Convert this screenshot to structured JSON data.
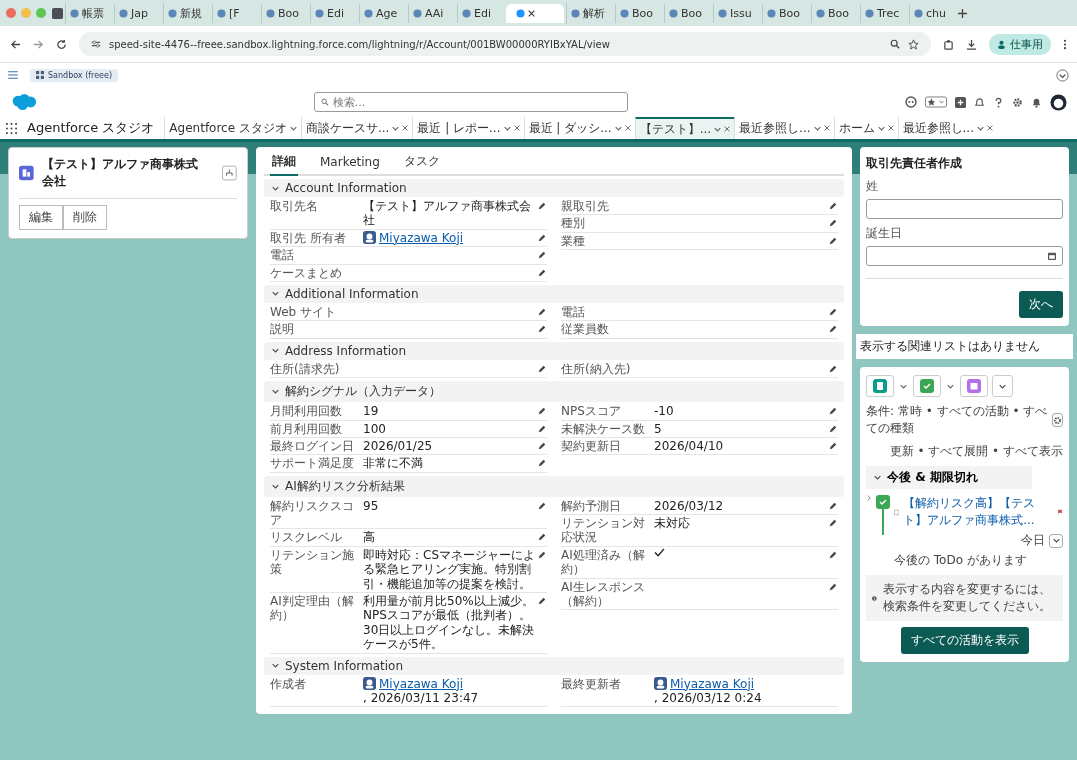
{
  "browser": {
    "tabs": [
      {
        "label": "帳票",
        "selected": false
      },
      {
        "label": "Jap",
        "selected": false
      },
      {
        "label": "新規",
        "selected": false
      },
      {
        "label": "[F",
        "selected": false
      },
      {
        "label": "Boo",
        "selected": false
      },
      {
        "label": "Edi",
        "selected": false
      },
      {
        "label": "Age",
        "selected": false
      },
      {
        "label": "AAi",
        "selected": false
      },
      {
        "label": "Edi",
        "selected": false
      },
      {
        "selected": true
      },
      {
        "label": "解析",
        "selected": false
      },
      {
        "label": "Boo",
        "selected": false
      },
      {
        "label": "Boo",
        "selected": false
      },
      {
        "label": "Issu",
        "selected": false
      },
      {
        "label": "Boo",
        "selected": false
      },
      {
        "label": "Boo",
        "selected": false
      },
      {
        "label": "Trec",
        "selected": false
      },
      {
        "label": "chu",
        "selected": false
      }
    ],
    "address": "speed-site-4476--freee.sandbox.lightning.force.com/lightning/r/Account/001BW00000RYIBxYAL/view",
    "profile": "仕事用"
  },
  "sandbox": "Sandbox (freee)",
  "search": {
    "placeholder": "検索..."
  },
  "app_name": "Agentforce スタジオ",
  "workspace_tabs": [
    {
      "label": "Agentforce スタジオ",
      "selected": false
    },
    {
      "label": "商談ケースサ...",
      "selected": false
    },
    {
      "label": "最近 | レポー...",
      "selected": false
    },
    {
      "label": "最近 | ダッシ...",
      "selected": false
    },
    {
      "label": "【テスト】...",
      "selected": true
    },
    {
      "label": "最近参照し...",
      "selected": false
    },
    {
      "label": "ホーム",
      "selected": false
    },
    {
      "label": "最近参照し...",
      "selected": false
    }
  ],
  "record": {
    "title": "【テスト】アルファ商事株式会社",
    "actions": [
      "編集",
      "削除"
    ]
  },
  "detail_tabs": [
    {
      "label": "詳細",
      "selected": true
    },
    {
      "label": "Marketing",
      "selected": false
    },
    {
      "label": "タスク",
      "selected": false
    }
  ],
  "sections": [
    {
      "title": "Account Information",
      "expanded": true,
      "left": [
        {
          "label": "取引先名",
          "kind": "text",
          "value": "【テスト】アルファ商事株式会社",
          "editable": true
        },
        {
          "label": "取引先 所有者",
          "kind": "user",
          "value": "Miyazawa Koji",
          "editable": true
        },
        {
          "label": "電話",
          "kind": "text",
          "editable": true
        },
        {
          "label": "ケースまとめ",
          "kind": "text",
          "editable": true
        }
      ],
      "right": [
        {
          "label": "親取引先",
          "kind": "text",
          "editable": true
        },
        {
          "label": "種別",
          "kind": "text",
          "editable": true
        },
        {
          "label": "業種",
          "kind": "text",
          "editable": true
        }
      ]
    },
    {
      "title": "Additional Information",
      "expanded": true,
      "left": [
        {
          "label": "Web サイト",
          "kind": "text",
          "editable": true
        },
        {
          "label": "説明",
          "kind": "text",
          "editable": true
        }
      ],
      "right": [
        {
          "label": "電話",
          "kind": "text",
          "editable": true
        },
        {
          "label": "従業員数",
          "kind": "text",
          "editable": true
        }
      ]
    },
    {
      "title": "Address Information",
      "expanded": true,
      "left": [
        {
          "label": "住所(請求先)",
          "kind": "text",
          "editable": true
        }
      ],
      "right": [
        {
          "label": "住所(納入先)",
          "kind": "text",
          "editable": true
        }
      ]
    },
    {
      "title": "解約シグナル（入力データ）",
      "expanded": true,
      "left": [
        {
          "label": "月間利用回数",
          "kind": "text",
          "value": "19",
          "editable": true
        },
        {
          "label": "前月利用回数",
          "kind": "text",
          "value": "100",
          "editable": true
        },
        {
          "label": "最終ログイン日",
          "kind": "text",
          "value": "2026/01/25",
          "editable": true
        },
        {
          "label": "サポート満足度",
          "kind": "text",
          "value": "非常に不満",
          "editable": true
        }
      ],
      "right": [
        {
          "label": "NPSスコア",
          "kind": "text",
          "value": "-10",
          "editable": true
        },
        {
          "label": "未解決ケース数",
          "kind": "text",
          "value": "5",
          "editable": true
        },
        {
          "label": "契約更新日",
          "kind": "text",
          "value": "2026/04/10",
          "editable": true
        }
      ]
    },
    {
      "title": "AI解約リスク分析結果",
      "expanded": true,
      "left": [
        {
          "label": "解約リスクスコア",
          "kind": "text",
          "value": "95",
          "editable": true
        },
        {
          "label": "リスクレベル",
          "kind": "text",
          "value": "高",
          "editable": true
        },
        {
          "label": "リテンション施策",
          "kind": "text",
          "value": "即時対応：CSマネージャーによる緊急ヒアリング実施。特別割引・機能追加等の提案を検討。",
          "editable": true
        },
        {
          "label": "AI判定理由（解約）",
          "kind": "text",
          "value": "利用量が前月比50%以上減少。NPSスコアが最低（批判者）。30日以上ログインなし。未解決ケースが5件。",
          "editable": true
        }
      ],
      "right": [
        {
          "label": "解約予測日",
          "kind": "text",
          "value": "2026/03/12",
          "editable": true
        },
        {
          "label": "リテンション対応状況",
          "kind": "text",
          "value": "未対応",
          "editable": true
        },
        {
          "label": "AI処理済み（解約）",
          "kind": "check",
          "checked": true,
          "editable": true
        },
        {
          "label": "AI生レスポンス（解約）",
          "kind": "text",
          "editable": true
        }
      ]
    },
    {
      "title": "System Information",
      "expanded": true,
      "left": [
        {
          "label": "作成者",
          "kind": "user",
          "value": "Miyazawa Koji",
          "suffix": ", 2026/03/11 23:47",
          "editable": false
        }
      ],
      "right": [
        {
          "label": "最終更新者",
          "kind": "user",
          "value": "Miyazawa Koji",
          "suffix": ", 2026/03/12 0:24",
          "editable": false
        }
      ]
    }
  ],
  "quick_create": {
    "title": "取引先責任者作成",
    "fields": [
      {
        "label": "姓",
        "kind": "text"
      },
      {
        "label": "誕生日",
        "kind": "date"
      }
    ],
    "button": "次へ"
  },
  "related_note": "表示する関連リストはありません",
  "activity": {
    "filter": "条件: 常時 • すべての活動 • すべての種類",
    "links": "更新 • すべて展開 • すべて表示",
    "group": {
      "title": "今後 & 期限切れ",
      "expanded": true
    },
    "task": {
      "title": "【解約リスク高】【テスト】アルファ商事株式...",
      "checked": false,
      "due": "今日"
    },
    "empty": "今後の ToDo があります",
    "info": "表示する内容を変更するには、検索条件を変更してください。",
    "button": "すべての活動を表示"
  }
}
